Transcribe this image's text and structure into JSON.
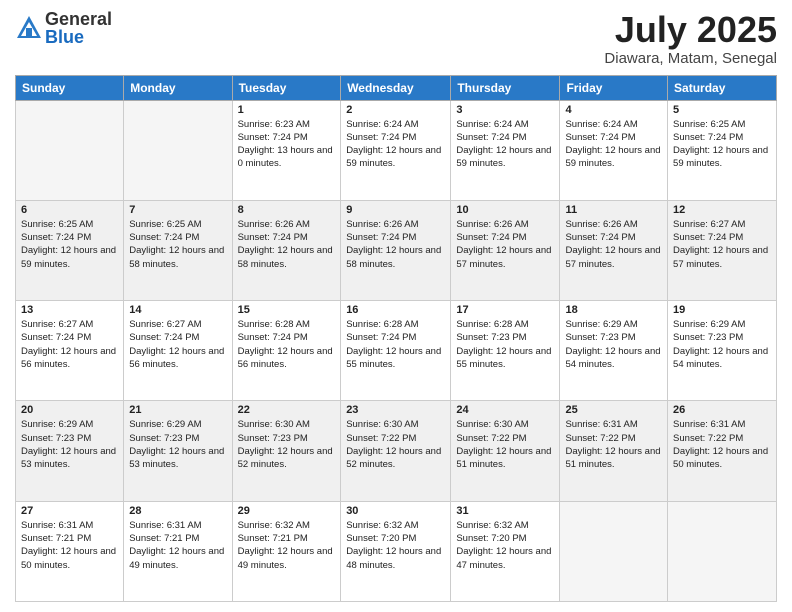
{
  "logo": {
    "general": "General",
    "blue": "Blue"
  },
  "title": {
    "month": "July 2025",
    "location": "Diawara, Matam, Senegal"
  },
  "days_of_week": [
    "Sunday",
    "Monday",
    "Tuesday",
    "Wednesday",
    "Thursday",
    "Friday",
    "Saturday"
  ],
  "weeks": [
    [
      {
        "day": "",
        "sunrise": "",
        "sunset": "",
        "daylight": ""
      },
      {
        "day": "",
        "sunrise": "",
        "sunset": "",
        "daylight": ""
      },
      {
        "day": "1",
        "sunrise": "Sunrise: 6:23 AM",
        "sunset": "Sunset: 7:24 PM",
        "daylight": "Daylight: 13 hours and 0 minutes."
      },
      {
        "day": "2",
        "sunrise": "Sunrise: 6:24 AM",
        "sunset": "Sunset: 7:24 PM",
        "daylight": "Daylight: 12 hours and 59 minutes."
      },
      {
        "day": "3",
        "sunrise": "Sunrise: 6:24 AM",
        "sunset": "Sunset: 7:24 PM",
        "daylight": "Daylight: 12 hours and 59 minutes."
      },
      {
        "day": "4",
        "sunrise": "Sunrise: 6:24 AM",
        "sunset": "Sunset: 7:24 PM",
        "daylight": "Daylight: 12 hours and 59 minutes."
      },
      {
        "day": "5",
        "sunrise": "Sunrise: 6:25 AM",
        "sunset": "Sunset: 7:24 PM",
        "daylight": "Daylight: 12 hours and 59 minutes."
      }
    ],
    [
      {
        "day": "6",
        "sunrise": "Sunrise: 6:25 AM",
        "sunset": "Sunset: 7:24 PM",
        "daylight": "Daylight: 12 hours and 59 minutes."
      },
      {
        "day": "7",
        "sunrise": "Sunrise: 6:25 AM",
        "sunset": "Sunset: 7:24 PM",
        "daylight": "Daylight: 12 hours and 58 minutes."
      },
      {
        "day": "8",
        "sunrise": "Sunrise: 6:26 AM",
        "sunset": "Sunset: 7:24 PM",
        "daylight": "Daylight: 12 hours and 58 minutes."
      },
      {
        "day": "9",
        "sunrise": "Sunrise: 6:26 AM",
        "sunset": "Sunset: 7:24 PM",
        "daylight": "Daylight: 12 hours and 58 minutes."
      },
      {
        "day": "10",
        "sunrise": "Sunrise: 6:26 AM",
        "sunset": "Sunset: 7:24 PM",
        "daylight": "Daylight: 12 hours and 57 minutes."
      },
      {
        "day": "11",
        "sunrise": "Sunrise: 6:26 AM",
        "sunset": "Sunset: 7:24 PM",
        "daylight": "Daylight: 12 hours and 57 minutes."
      },
      {
        "day": "12",
        "sunrise": "Sunrise: 6:27 AM",
        "sunset": "Sunset: 7:24 PM",
        "daylight": "Daylight: 12 hours and 57 minutes."
      }
    ],
    [
      {
        "day": "13",
        "sunrise": "Sunrise: 6:27 AM",
        "sunset": "Sunset: 7:24 PM",
        "daylight": "Daylight: 12 hours and 56 minutes."
      },
      {
        "day": "14",
        "sunrise": "Sunrise: 6:27 AM",
        "sunset": "Sunset: 7:24 PM",
        "daylight": "Daylight: 12 hours and 56 minutes."
      },
      {
        "day": "15",
        "sunrise": "Sunrise: 6:28 AM",
        "sunset": "Sunset: 7:24 PM",
        "daylight": "Daylight: 12 hours and 56 minutes."
      },
      {
        "day": "16",
        "sunrise": "Sunrise: 6:28 AM",
        "sunset": "Sunset: 7:24 PM",
        "daylight": "Daylight: 12 hours and 55 minutes."
      },
      {
        "day": "17",
        "sunrise": "Sunrise: 6:28 AM",
        "sunset": "Sunset: 7:23 PM",
        "daylight": "Daylight: 12 hours and 55 minutes."
      },
      {
        "day": "18",
        "sunrise": "Sunrise: 6:29 AM",
        "sunset": "Sunset: 7:23 PM",
        "daylight": "Daylight: 12 hours and 54 minutes."
      },
      {
        "day": "19",
        "sunrise": "Sunrise: 6:29 AM",
        "sunset": "Sunset: 7:23 PM",
        "daylight": "Daylight: 12 hours and 54 minutes."
      }
    ],
    [
      {
        "day": "20",
        "sunrise": "Sunrise: 6:29 AM",
        "sunset": "Sunset: 7:23 PM",
        "daylight": "Daylight: 12 hours and 53 minutes."
      },
      {
        "day": "21",
        "sunrise": "Sunrise: 6:29 AM",
        "sunset": "Sunset: 7:23 PM",
        "daylight": "Daylight: 12 hours and 53 minutes."
      },
      {
        "day": "22",
        "sunrise": "Sunrise: 6:30 AM",
        "sunset": "Sunset: 7:23 PM",
        "daylight": "Daylight: 12 hours and 52 minutes."
      },
      {
        "day": "23",
        "sunrise": "Sunrise: 6:30 AM",
        "sunset": "Sunset: 7:22 PM",
        "daylight": "Daylight: 12 hours and 52 minutes."
      },
      {
        "day": "24",
        "sunrise": "Sunrise: 6:30 AM",
        "sunset": "Sunset: 7:22 PM",
        "daylight": "Daylight: 12 hours and 51 minutes."
      },
      {
        "day": "25",
        "sunrise": "Sunrise: 6:31 AM",
        "sunset": "Sunset: 7:22 PM",
        "daylight": "Daylight: 12 hours and 51 minutes."
      },
      {
        "day": "26",
        "sunrise": "Sunrise: 6:31 AM",
        "sunset": "Sunset: 7:22 PM",
        "daylight": "Daylight: 12 hours and 50 minutes."
      }
    ],
    [
      {
        "day": "27",
        "sunrise": "Sunrise: 6:31 AM",
        "sunset": "Sunset: 7:21 PM",
        "daylight": "Daylight: 12 hours and 50 minutes."
      },
      {
        "day": "28",
        "sunrise": "Sunrise: 6:31 AM",
        "sunset": "Sunset: 7:21 PM",
        "daylight": "Daylight: 12 hours and 49 minutes."
      },
      {
        "day": "29",
        "sunrise": "Sunrise: 6:32 AM",
        "sunset": "Sunset: 7:21 PM",
        "daylight": "Daylight: 12 hours and 49 minutes."
      },
      {
        "day": "30",
        "sunrise": "Sunrise: 6:32 AM",
        "sunset": "Sunset: 7:20 PM",
        "daylight": "Daylight: 12 hours and 48 minutes."
      },
      {
        "day": "31",
        "sunrise": "Sunrise: 6:32 AM",
        "sunset": "Sunset: 7:20 PM",
        "daylight": "Daylight: 12 hours and 47 minutes."
      },
      {
        "day": "",
        "sunrise": "",
        "sunset": "",
        "daylight": ""
      },
      {
        "day": "",
        "sunrise": "",
        "sunset": "",
        "daylight": ""
      }
    ]
  ]
}
